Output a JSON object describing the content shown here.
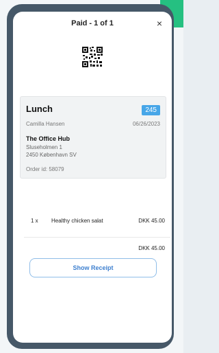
{
  "header": {
    "title": "Paid - 1 of 1",
    "close_icon": "×"
  },
  "order": {
    "title": "Lunch",
    "badge": "245",
    "person": "Camilla Hansen",
    "date": "06/26/2023",
    "venue": "The Office Hub",
    "address_line1": "Sluseholmen 1",
    "address_line2": "2450 København SV",
    "order_id": "Order id: 58079"
  },
  "items": [
    {
      "qty": "1 x",
      "name": "Healthy chicken salat",
      "price": "DKK 45.00"
    }
  ],
  "total": {
    "price": "DKK 45.00"
  },
  "actions": {
    "show_receipt": "Show Receipt"
  },
  "colors": {
    "accent": "#47a6e8",
    "frame": "#465868",
    "button_text": "#3d7fcf"
  }
}
